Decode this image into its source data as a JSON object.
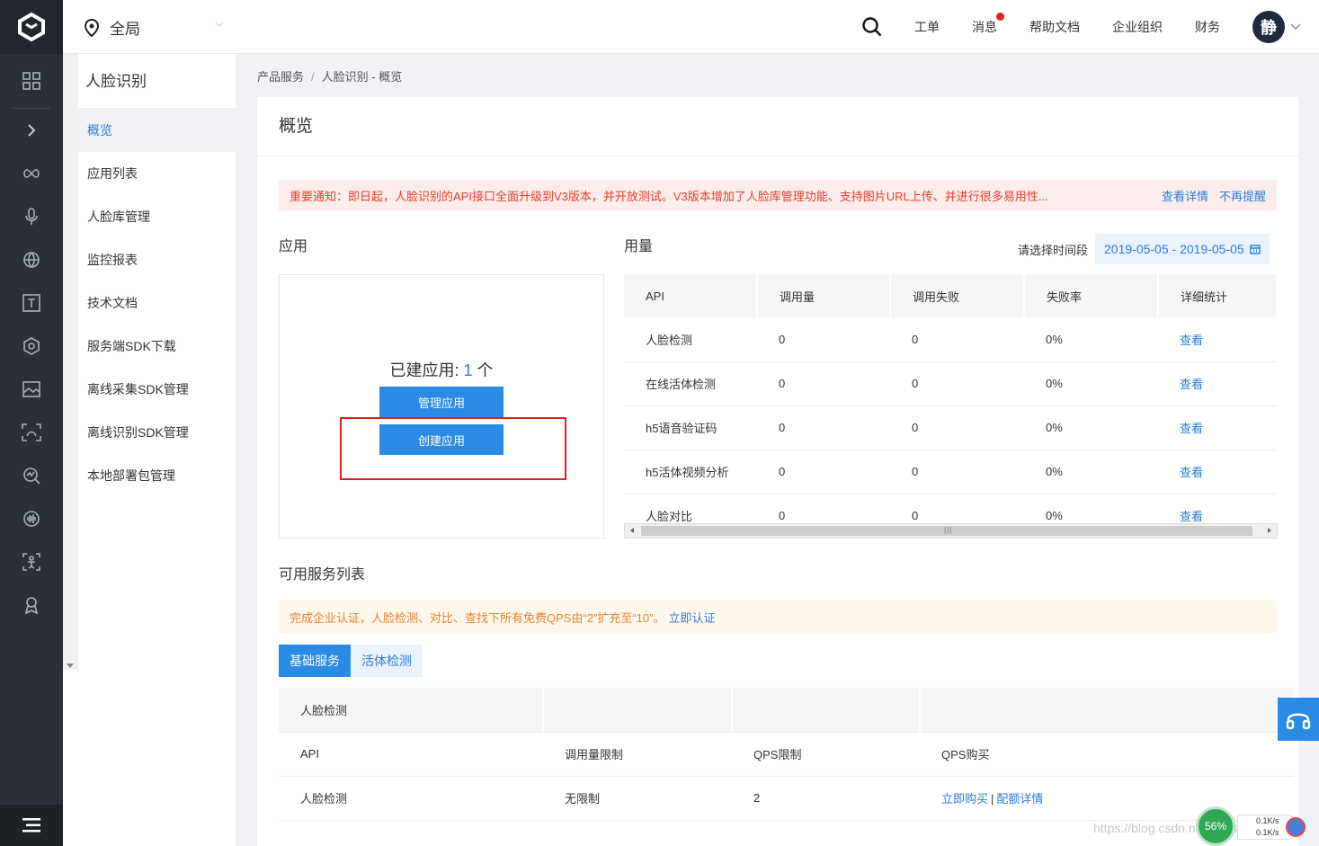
{
  "topbar": {
    "region": "全局",
    "nav": [
      "工单",
      "消息",
      "帮助文档",
      "企业组织",
      "财务"
    ],
    "avatar": "静"
  },
  "sidebar": {
    "title": "人脸识别",
    "items": [
      {
        "label": "概览",
        "active": true
      },
      {
        "label": "应用列表"
      },
      {
        "label": "人脸库管理"
      },
      {
        "label": "监控报表"
      },
      {
        "label": "技术文档"
      },
      {
        "label": "服务端SDK下载"
      },
      {
        "label": "离线采集SDK管理"
      },
      {
        "label": "离线识别SDK管理"
      },
      {
        "label": "本地部署包管理"
      }
    ]
  },
  "breadcrumb": {
    "parent": "产品服务",
    "sep": "/",
    "current": "人脸识别 - 概览"
  },
  "page": {
    "title": "概览"
  },
  "notice": {
    "text": "重要通知：即日起，人脸识别的API接口全面升级到V3版本，并开放测试。V3版本增加了人脸库管理功能、支持图片URL上传、并进行很多易用性...",
    "detail_link": "查看详情",
    "dismiss_link": "不再提醒"
  },
  "apps": {
    "section_title": "应用",
    "count_label": "已建应用: ",
    "count": "1",
    "count_unit": " 个",
    "manage_button": "管理应用",
    "create_button": "创建应用"
  },
  "usage": {
    "section_title": "用量",
    "date_label": "请选择时间段",
    "date_range": "2019-05-05 - 2019-05-05",
    "columns": [
      "API",
      "调用量",
      "调用失败",
      "失败率",
      "详细统计"
    ],
    "rows": [
      {
        "api": "人脸检测",
        "calls": "0",
        "fails": "0",
        "rate": "0%",
        "link": "查看"
      },
      {
        "api": "在线活体检测",
        "calls": "0",
        "fails": "0",
        "rate": "0%",
        "link": "查看"
      },
      {
        "api": "h5语音验证码",
        "calls": "0",
        "fails": "0",
        "rate": "0%",
        "link": "查看"
      },
      {
        "api": "h5活体视频分析",
        "calls": "0",
        "fails": "0",
        "rate": "0%",
        "link": "查看"
      },
      {
        "api": "人脸对比",
        "calls": "0",
        "fails": "0",
        "rate": "0%",
        "link": "查看"
      }
    ]
  },
  "services": {
    "section_title": "可用服务列表",
    "notice": "完成企业认证，人脸检测、对比、查找下所有免费QPS由“2”扩充至“10”。",
    "notice_link": "立即认证",
    "tabs": [
      "基础服务",
      "活体检测"
    ],
    "group_name": "人脸检测",
    "columns": [
      "API",
      "调用量限制",
      "QPS限制",
      "QPS购买"
    ],
    "rows": [
      {
        "api": "人脸检测",
        "limit": "无限制",
        "qps": "2",
        "buy": "立即购买",
        "detail": "配额详情"
      }
    ]
  },
  "speed_widget": {
    "percent": "56%",
    "up": "0.1K/s",
    "down": "0.1K/s"
  },
  "watermark": "https://blog.csdn.net/qq_34"
}
